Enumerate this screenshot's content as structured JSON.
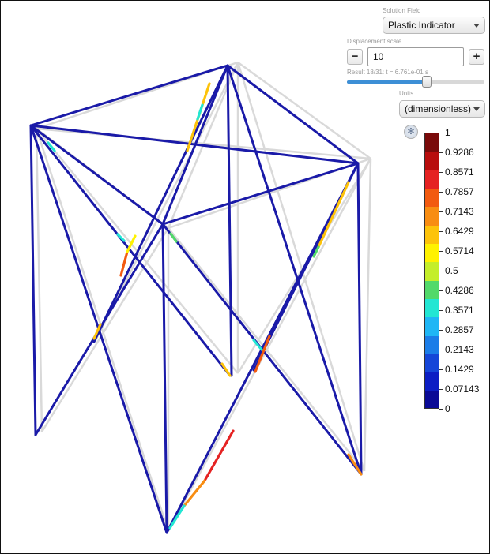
{
  "panel": {
    "solution_field_label": "Solution Field",
    "solution_field_value": "Plastic Indicator",
    "displacement_scale_label": "Displacement scale",
    "minus_label": "−",
    "plus_label": "+",
    "displacement_scale_value": "10",
    "result_text": "Result 18/31: t = 6.761e-01 s",
    "result_slider_fraction": 0.58,
    "units_label": "Units",
    "units_value": "(dimensionless)",
    "settings_icon": "gear-icon"
  },
  "legend": {
    "ticks": [
      "1",
      "0.9286",
      "0.8571",
      "0.7857",
      "0.7143",
      "0.6429",
      "0.5714",
      "0.5",
      "0.4286",
      "0.3571",
      "0.2857",
      "0.2143",
      "0.1429",
      "0.07143",
      "0"
    ],
    "colors": [
      "#7a0a0a",
      "#b80d0d",
      "#e52222",
      "#f25a10",
      "#f88d12",
      "#fdc30a",
      "#fff200",
      "#c4ee2a",
      "#52d96a",
      "#22e6d3",
      "#1fb6f5",
      "#1b7de8",
      "#1546d8",
      "#0c1ec4",
      "#0a0a96"
    ]
  },
  "colors": {
    "beam": "#1a1aa8",
    "ghost": "#d9d9d9"
  }
}
